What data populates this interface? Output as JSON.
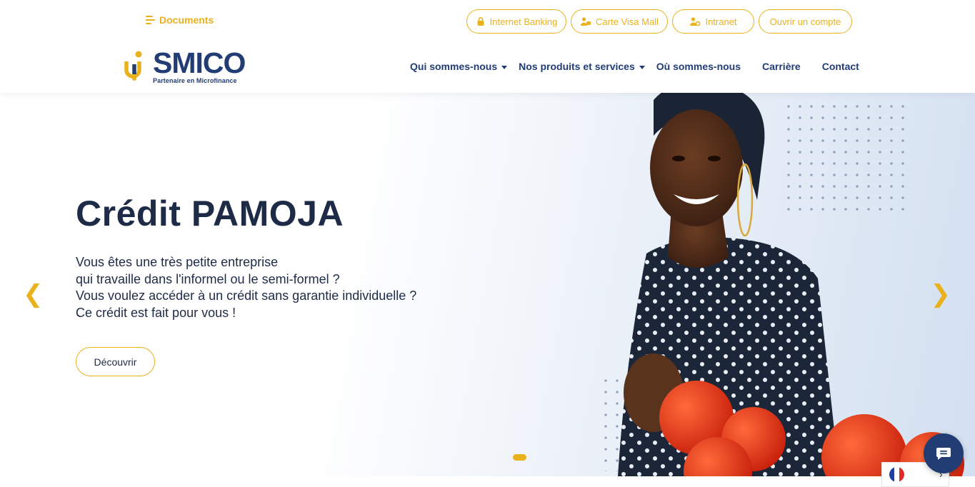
{
  "topbar": {
    "documents_label": "Documents",
    "links": [
      {
        "label": "Internet Banking",
        "icon": "lock-icon"
      },
      {
        "label": "Carte Visa Mall",
        "icon": "users-icon"
      },
      {
        "label": "Intranet",
        "icon": "user-gear-icon"
      },
      {
        "label": "Ouvrir un compte",
        "icon": ""
      }
    ]
  },
  "logo": {
    "name": "SMICO",
    "tagline": "Partenaire en Microfinance"
  },
  "nav": {
    "items": [
      {
        "label": "Qui sommes-nous",
        "dropdown": true
      },
      {
        "label": "Nos produits et services",
        "dropdown": true
      },
      {
        "label": "Où sommes-nous",
        "dropdown": false
      },
      {
        "label": "Carrière",
        "dropdown": false
      },
      {
        "label": "Contact",
        "dropdown": false
      }
    ]
  },
  "hero": {
    "title": "Crédit PAMOJA",
    "lines": [
      "Vous êtes une très petite entreprise",
      "qui travaille dans l'informel ou le semi-formel ?",
      "Vous voulez accéder à un crédit sans garantie individuelle ?",
      "Ce crédit est fait pour vous !"
    ],
    "cta_label": "Découvrir",
    "prev_arrow": "❮",
    "next_arrow": "❯"
  },
  "language": {
    "current": "fr",
    "chevron": "›"
  },
  "colors": {
    "accent": "#e9b11c",
    "brand": "#213d74",
    "text": "#1e2b47"
  }
}
